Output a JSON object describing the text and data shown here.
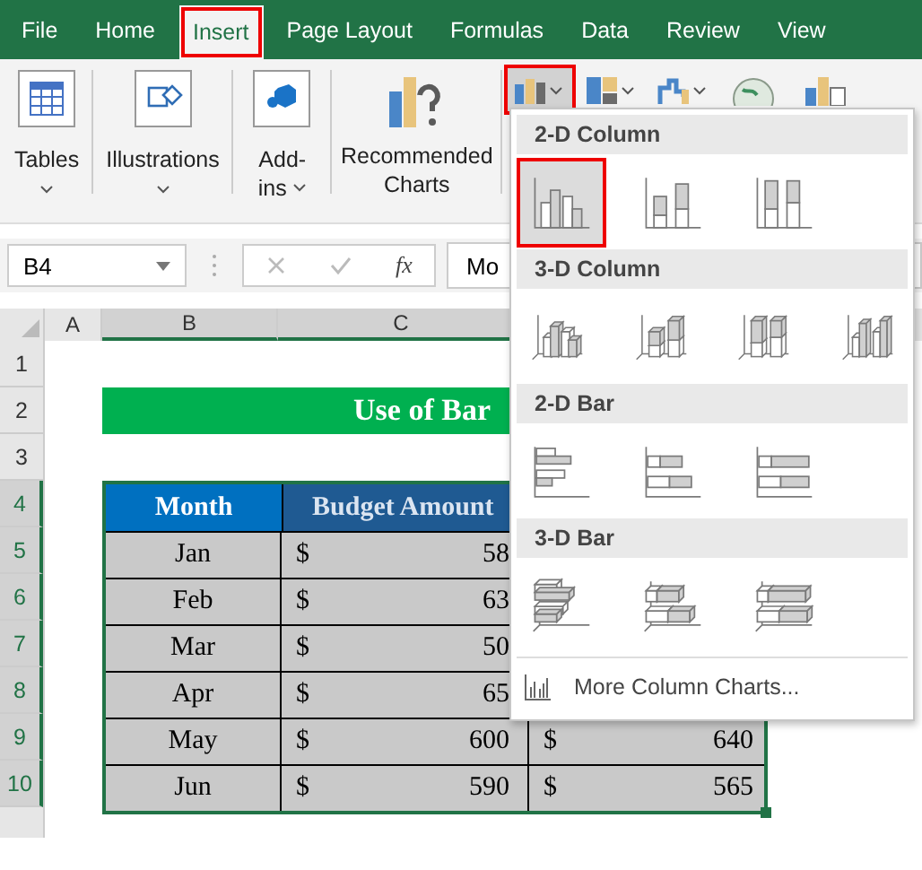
{
  "ribbon_tabs": [
    {
      "label": "File",
      "selected": false
    },
    {
      "label": "Home",
      "selected": false
    },
    {
      "label": "Insert",
      "selected": true
    },
    {
      "label": "Page Layout",
      "selected": false
    },
    {
      "label": "Formulas",
      "selected": false
    },
    {
      "label": "Data",
      "selected": false
    },
    {
      "label": "Review",
      "selected": false
    },
    {
      "label": "View",
      "selected": false
    }
  ],
  "ribbon_groups": [
    {
      "kind": "tables",
      "label": "Tables",
      "has_menu": true
    },
    {
      "kind": "illustrations",
      "label": "Illustrations",
      "has_menu": true
    },
    {
      "kind": "addins",
      "label": "Add-ins",
      "has_menu": true
    },
    {
      "kind": "recommended",
      "label": "Recommended Charts",
      "has_menu": false
    }
  ],
  "chart_menu_open": true,
  "formula_bar": {
    "name_box": "B4",
    "function_label": "fx",
    "content": "Mo"
  },
  "sheet": {
    "column_headers": [
      {
        "label": "A",
        "selected": false
      },
      {
        "label": "B",
        "selected": true
      },
      {
        "label": "C",
        "selected": true
      }
    ],
    "row_numbers": [
      {
        "label": "1",
        "selected": false
      },
      {
        "label": "2",
        "selected": false
      },
      {
        "label": "3",
        "selected": false
      },
      {
        "label": "4",
        "selected": true
      },
      {
        "label": "5",
        "selected": true
      },
      {
        "label": "6",
        "selected": true
      },
      {
        "label": "7",
        "selected": true
      },
      {
        "label": "8",
        "selected": true
      },
      {
        "label": "9",
        "selected": true
      },
      {
        "label": "10",
        "selected": true
      }
    ],
    "title": "Use of Bar",
    "table": {
      "columns": [
        "Month",
        "Budget Amount"
      ],
      "rows": [
        {
          "month": "Jan",
          "budget": {
            "currency": "$",
            "amount": "58"
          }
        },
        {
          "month": "Feb",
          "budget": {
            "currency": "$",
            "amount": "63"
          }
        },
        {
          "month": "Mar",
          "budget": {
            "currency": "$",
            "amount": "50"
          }
        },
        {
          "month": "Apr",
          "budget": {
            "currency": "$",
            "amount": "65"
          }
        },
        {
          "month": "May",
          "budget": {
            "currency": "$",
            "amount": "600"
          },
          "column_3": {
            "currency": "$",
            "amount": "640"
          }
        },
        {
          "month": "Jun",
          "budget": {
            "currency": "$",
            "amount": "590"
          },
          "column_3": {
            "currency": "$",
            "amount": "565"
          }
        }
      ]
    }
  },
  "chart_menu": {
    "sections": [
      {
        "title": "2-D Column",
        "items": [
          {
            "kind": "col-clustered",
            "selected": true
          },
          {
            "kind": "col-stacked",
            "selected": false
          },
          {
            "kind": "col-stacked100",
            "selected": false
          }
        ]
      },
      {
        "title": "3-D Column",
        "items": [
          {
            "kind": "col3d-clustered",
            "selected": false
          },
          {
            "kind": "col3d-stacked",
            "selected": false
          },
          {
            "kind": "col3d-stacked100",
            "selected": false
          },
          {
            "kind": "col3d",
            "selected": false
          }
        ]
      },
      {
        "title": "2-D Bar",
        "items": [
          {
            "kind": "bar-clustered",
            "selected": false
          },
          {
            "kind": "bar-stacked",
            "selected": false
          },
          {
            "kind": "bar-stacked100",
            "selected": false
          }
        ]
      },
      {
        "title": "3-D Bar",
        "items": [
          {
            "kind": "bar3d-clustered",
            "selected": false
          },
          {
            "kind": "bar3d-stacked",
            "selected": false
          },
          {
            "kind": "bar3d-stacked100",
            "selected": false
          }
        ]
      }
    ],
    "more_link": "More Column Charts..."
  }
}
